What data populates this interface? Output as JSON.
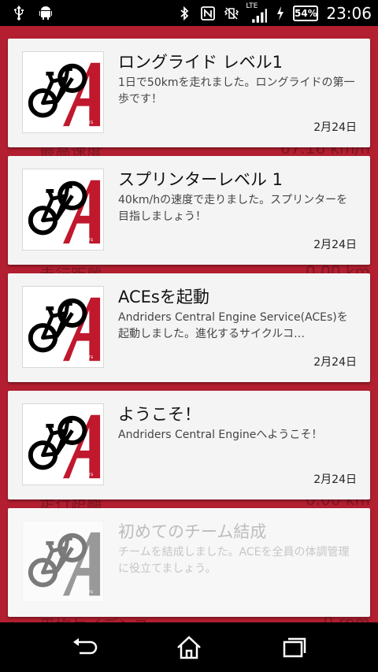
{
  "status_bar": {
    "time": "23:06",
    "battery": "54%",
    "network": "LTE",
    "icons_left": [
      "usb-icon",
      "android-debug-icon"
    ],
    "icons_right": [
      "bluetooth-icon",
      "nfc-icon",
      "vibrate-icon",
      "signal-icon",
      "charging-icon"
    ]
  },
  "background": {
    "labels": [
      "最高速度",
      "走行距離",
      "走行距離",
      "平均ケイデンス"
    ],
    "values": [
      "67.16 km/h",
      "0.00 km",
      "0.00 km",
      "0 rpm"
    ]
  },
  "cards": [
    {
      "title": "ロングライド レベル1",
      "description": "1日で50kmを走れました。ロングライドの第一歩です！",
      "date": "2月24日"
    },
    {
      "title": "スプリンターレベル 1",
      "description": "40km/hの速度で走りました。スプリンターを目指しましょう！",
      "date": "2月24日"
    },
    {
      "title": "ACEsを起動",
      "description": "Andriders Central Engine Service(ACEs)を起動しました。進化するサイクルコ…",
      "date": "2月24日"
    },
    {
      "title": "ようこそ！",
      "description": "Andriders Central Engineへようこそ！",
      "date": "2月24日"
    },
    {
      "title": "初めてのチーム結成",
      "description": "チームを結成しました。ACEを全員の体調管理に役立てましょう。",
      "date": ""
    }
  ],
  "logo": {
    "text": "Andriders",
    "icon": "bike-a-logo-icon"
  },
  "colors": {
    "accent": "#b31f30",
    "card": "#f4f4f4",
    "logo_red": "#c0182d"
  },
  "nav_bar": {
    "icons": [
      "back-icon",
      "home-icon",
      "recents-icon"
    ]
  }
}
